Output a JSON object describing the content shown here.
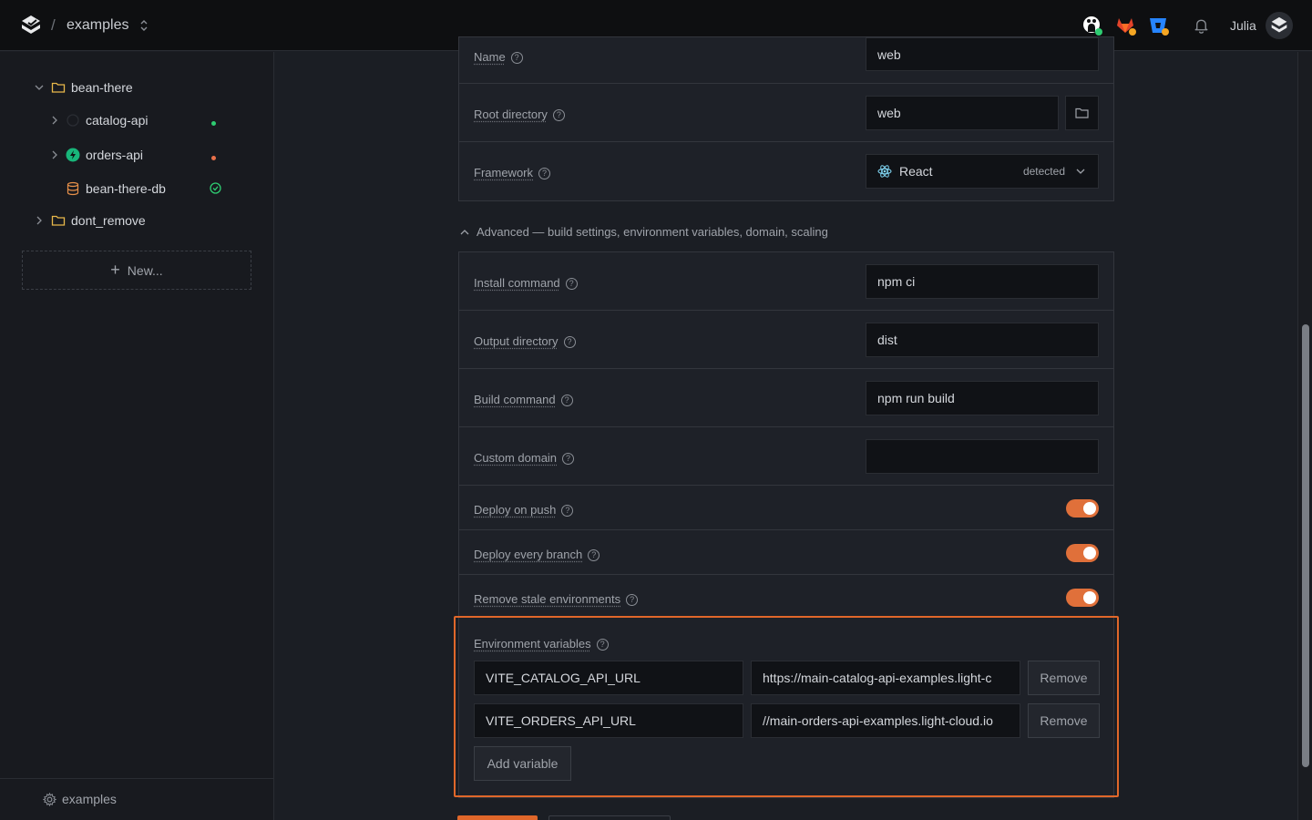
{
  "topbar": {
    "workspace": "examples",
    "separator": "/",
    "username": "Julia"
  },
  "sidebar": {
    "tree": [
      {
        "label": "bean-there",
        "type": "folder",
        "expanded": true
      },
      {
        "label": "catalog-api",
        "type": "service",
        "status_color": "#2ecc71"
      },
      {
        "label": "orders-api",
        "type": "service",
        "status_color": "#e8704a"
      },
      {
        "label": "bean-there-db",
        "type": "database",
        "status": "ok"
      },
      {
        "label": "dont_remove",
        "type": "folder",
        "expanded": false
      }
    ],
    "new_label": "New...",
    "footer_label": "examples"
  },
  "settings": {
    "name_label": "Name",
    "name_value": "web",
    "root_label": "Root directory",
    "root_value": "web",
    "framework_label": "Framework",
    "framework_value": "React",
    "framework_badge": "detected",
    "advanced_label": "Advanced — build settings, environment variables, domain, scaling",
    "install_label": "Install command",
    "install_value": "npm ci",
    "output_label": "Output directory",
    "output_value": "dist",
    "build_label": "Build command",
    "build_value": "npm run build",
    "domain_label": "Custom domain",
    "domain_value": "",
    "deploy_push_label": "Deploy on push",
    "deploy_branch_label": "Deploy every branch",
    "stale_label": "Remove stale environments"
  },
  "env": {
    "label": "Environment variables",
    "vars": [
      {
        "key": "VITE_CATALOG_API_URL",
        "value": "https://main-catalog-api-examples.light-c"
      },
      {
        "key": "VITE_ORDERS_API_URL",
        "value": "//main-orders-api-examples.light-cloud.io"
      }
    ],
    "remove_label": "Remove",
    "add_label": "Add variable"
  },
  "colors": {
    "accent": "#e0672a",
    "toggle_on": "#e0703a"
  }
}
